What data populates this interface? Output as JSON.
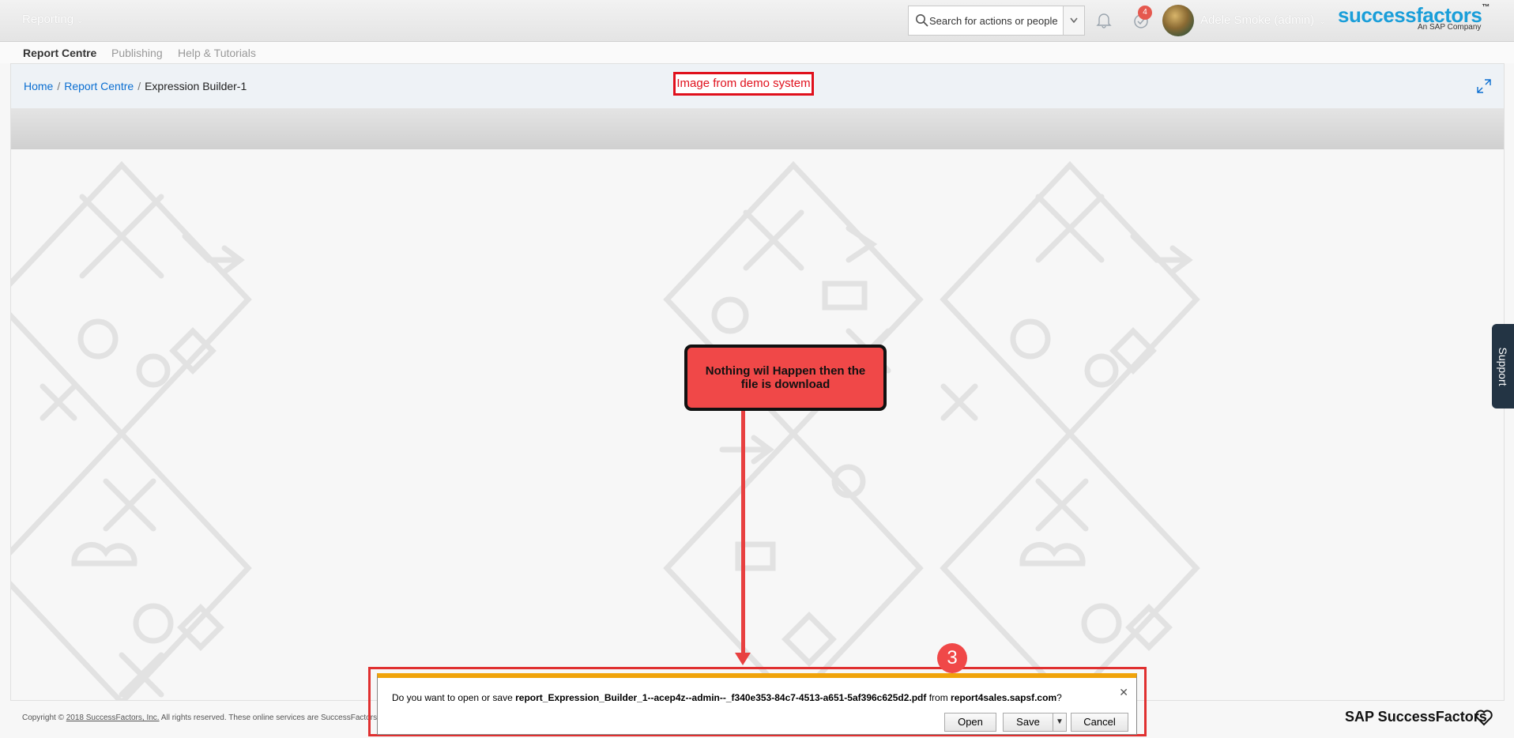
{
  "shell": {
    "module_menu": "Reporting",
    "search_placeholder": "Search for actions or people",
    "notification_count": "4",
    "user_name": "Adele Smoke (admin)",
    "logo_text": "successfactors",
    "logo_tm": "™",
    "logo_sub": "An SAP Company"
  },
  "subnav": {
    "tabs": [
      {
        "label": "Report Centre",
        "active": true
      },
      {
        "label": "Publishing",
        "active": false
      },
      {
        "label": "Help & Tutorials",
        "active": false
      }
    ]
  },
  "breadcrumb": {
    "items": [
      "Home",
      "Report Centre",
      "Expression Builder-1"
    ],
    "separator": "/"
  },
  "annotations": {
    "demo_label": "Image from demo system",
    "callout": "Nothing wil Happen then the file is download",
    "step_number": "3"
  },
  "support_tab": "Support",
  "footer": {
    "copyright_prefix": "Copyright ©",
    "copyright_link": "2018 SuccessFactors, Inc.",
    "copyright_suffix": "All rights reserved. These online services are SuccessFactors",
    "logo": "SAP SuccessFactors"
  },
  "download_bar": {
    "prompt": "Do you want to open or save",
    "filename": "report_Expression_Builder_1--acep4z--admin--_f340e353-84c7-4513-a651-5af396c625d2.pdf",
    "from": "from",
    "domain": "report4sales.sapsf.com",
    "question_mark": "?",
    "buttons": {
      "open": "Open",
      "save": "Save",
      "cancel": "Cancel"
    }
  },
  "colors": {
    "brand_blue": "#1a9ed9",
    "annotation_red": "#e0101c",
    "download_accent": "#f0a30a",
    "support_bg": "#233444"
  }
}
